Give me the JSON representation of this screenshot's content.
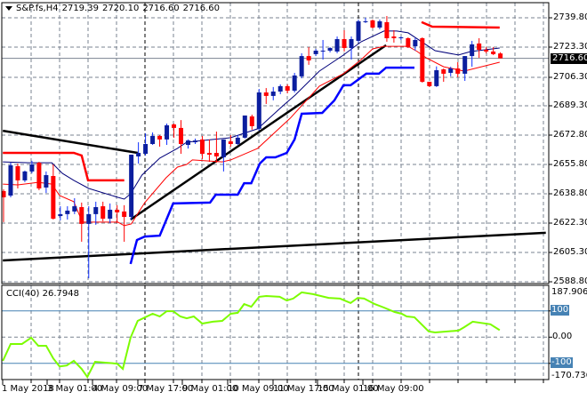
{
  "header": {
    "symbol": "S&P.fs,H4",
    "open": "2719.39",
    "high": "2720.10",
    "low": "2716.60",
    "close": "2716.60"
  },
  "price_axis": {
    "labels": [
      "2739.80",
      "2723.30",
      "2706.30",
      "2689.30",
      "2672.80",
      "2655.80",
      "2638.80",
      "2622.30",
      "2605.30",
      "2588.80"
    ],
    "current": "2716.60"
  },
  "cci": {
    "label": "CCI(40) 26.7948",
    "axis": {
      "max": "187.9065",
      "upper": "100",
      "zero": "0.00",
      "lower": "-100",
      "min": "-170.7363"
    }
  },
  "time_axis": {
    "labels": [
      "1 May 2018",
      "3 May 01:00",
      "4 May 09:00",
      "7 May 17:00",
      "9 May 01:00",
      "10 May 09:00",
      "11 May 17:00",
      "15 May 01:00",
      "16 May 09:00"
    ]
  },
  "colors": {
    "bull": "#0b1e9e",
    "bear": "#ff0000",
    "ma_fast": "#00007a",
    "ma_slow": "#ff0000",
    "channel_low": "#0000ff",
    "channel_high": "#ff0000",
    "trend": "#000000",
    "cci": "#7cfc00",
    "level": "#4682b4",
    "grid": "#7a8391"
  },
  "chart_data": {
    "type": "candlestick",
    "title": "S&P.fs,H4",
    "ylim": [
      2588.8,
      2739.8
    ],
    "ohlc": [
      [
        2640.7,
        2641.7,
        2622.9,
        2637.1
      ],
      [
        2638.1,
        2656.9,
        2637.1,
        2655.4
      ],
      [
        2654.9,
        2656.4,
        2642.2,
        2646.8
      ],
      [
        2646.8,
        2652.4,
        2645.8,
        2651.9
      ],
      [
        2651.9,
        2658.0,
        2650.9,
        2655.9
      ],
      [
        2656.9,
        2657.4,
        2641.2,
        2642.2
      ],
      [
        2642.7,
        2651.9,
        2639.6,
        2649.8
      ],
      [
        2649.3,
        2655.9,
        2624.4,
        2624.9
      ],
      [
        2626.4,
        2632.0,
        2623.9,
        2627.5
      ],
      [
        2627.5,
        2632.0,
        2624.4,
        2629.5
      ],
      [
        2629.0,
        2636.6,
        2627.5,
        2632.0
      ],
      [
        2631.5,
        2634.1,
        2611.7,
        2621.9
      ],
      [
        2621.9,
        2632.0,
        2590.8,
        2627.5
      ],
      [
        2627.5,
        2634.6,
        2621.4,
        2631.5
      ],
      [
        2632.0,
        2634.6,
        2623.4,
        2624.9
      ],
      [
        2624.9,
        2633.6,
        2622.4,
        2630.0
      ],
      [
        2630.0,
        2632.6,
        2622.4,
        2628.5
      ],
      [
        2629.0,
        2632.6,
        2611.7,
        2625.9
      ],
      [
        2625.9,
        2661.5,
        2624.4,
        2661.5
      ],
      [
        2660.5,
        2668.6,
        2656.4,
        2662.5
      ],
      [
        2662.0,
        2673.7,
        2661.0,
        2667.6
      ],
      [
        2667.6,
        2674.2,
        2667.1,
        2672.2
      ],
      [
        2672.2,
        2672.7,
        2666.1,
        2670.2
      ],
      [
        2670.2,
        2679.3,
        2667.1,
        2678.3
      ],
      [
        2678.8,
        2679.3,
        2671.2,
        2676.8
      ],
      [
        2676.8,
        2681.3,
        2662.0,
        2667.6
      ],
      [
        2667.1,
        2670.2,
        2665.0,
        2669.6
      ],
      [
        2668.6,
        2670.7,
        2667.6,
        2669.6
      ],
      [
        2670.2,
        2672.2,
        2659.0,
        2662.0
      ],
      [
        2662.5,
        2670.2,
        2657.4,
        2661.5
      ],
      [
        2662.5,
        2674.7,
        2656.9,
        2660.5
      ],
      [
        2660.0,
        2670.2,
        2651.9,
        2670.2
      ],
      [
        2669.1,
        2672.7,
        2666.1,
        2667.6
      ],
      [
        2667.6,
        2672.7,
        2667.1,
        2671.2
      ],
      [
        2671.2,
        2683.9,
        2670.7,
        2683.9
      ],
      [
        2683.4,
        2684.4,
        2675.8,
        2677.8
      ],
      [
        2676.3,
        2699.1,
        2675.3,
        2697.1
      ],
      [
        2697.1,
        2699.6,
        2690.5,
        2695.1
      ],
      [
        2695.1,
        2700.2,
        2692.6,
        2697.6
      ],
      [
        2697.6,
        2701.7,
        2696.1,
        2700.7
      ],
      [
        2700.7,
        2701.7,
        2696.6,
        2698.1
      ],
      [
        2698.1,
        2708.3,
        2697.1,
        2706.8
      ],
      [
        2706.3,
        2719.5,
        2705.2,
        2717.9
      ],
      [
        2717.9,
        2723.0,
        2712.9,
        2715.4
      ],
      [
        2719.0,
        2722.0,
        2717.9,
        2721.0
      ],
      [
        2720.5,
        2727.1,
        2715.9,
        2721.0
      ],
      [
        2721.0,
        2723.0,
        2720.0,
        2722.5
      ],
      [
        2720.5,
        2729.1,
        2719.5,
        2727.6
      ],
      [
        2727.6,
        2732.7,
        2720.5,
        2722.5
      ],
      [
        2722.5,
        2729.1,
        2715.9,
        2727.6
      ],
      [
        2726.6,
        2738.8,
        2725.6,
        2737.8
      ],
      [
        2737.3,
        2739.8,
        2736.8,
        2737.8
      ],
      [
        2738.3,
        2738.8,
        2733.7,
        2734.2
      ],
      [
        2734.2,
        2738.8,
        2733.2,
        2737.8
      ],
      [
        2737.3,
        2740.8,
        2726.1,
        2728.1
      ],
      [
        2729.1,
        2732.7,
        2725.6,
        2728.1
      ],
      [
        2728.1,
        2729.1,
        2727.1,
        2728.6
      ],
      [
        2728.1,
        2728.6,
        2722.5,
        2723.0
      ],
      [
        2723.5,
        2728.1,
        2721.0,
        2727.1
      ],
      [
        2728.1,
        2728.6,
        2702.7,
        2703.2
      ],
      [
        2703.2,
        2703.2,
        2700.2,
        2700.7
      ],
      [
        2700.7,
        2712.0,
        2700.2,
        2709.8
      ],
      [
        2710.3,
        2710.8,
        2703.2,
        2707.8
      ],
      [
        2708.3,
        2711.8,
        2706.3,
        2710.8
      ],
      [
        2710.8,
        2714.4,
        2705.8,
        2707.8
      ],
      [
        2707.8,
        2717.9,
        2703.7,
        2717.9
      ],
      [
        2717.9,
        2726.6,
        2711.8,
        2724.6
      ],
      [
        2725.1,
        2728.1,
        2716.9,
        2721.5
      ],
      [
        2721.5,
        2723.0,
        2719.5,
        2720.5
      ],
      [
        2720.5,
        2723.0,
        2718.5,
        2719.0
      ],
      [
        2719.39,
        2720.1,
        2716.6,
        2716.6
      ]
    ],
    "current_price": 2716.6,
    "indicators": {
      "ma_fast": [
        [
          -0.1,
          2657.4
        ],
        [
          3.6,
          2656.9
        ],
        [
          6.8,
          2656.9
        ],
        [
          8.3,
          2650.8
        ],
        [
          9.9,
          2646.8
        ],
        [
          12,
          2642.2
        ],
        [
          16.1,
          2637.1
        ],
        [
          17,
          2636.1
        ],
        [
          17.9,
          2639.1
        ],
        [
          19.5,
          2649.8
        ],
        [
          22,
          2659.5
        ],
        [
          24.5,
          2665.1
        ],
        [
          25.8,
          2668.6
        ],
        [
          29.5,
          2670.2
        ],
        [
          32,
          2671.2
        ],
        [
          35.8,
          2676.3
        ],
        [
          39.5,
          2690.0
        ],
        [
          41.1,
          2695.6
        ],
        [
          44.5,
          2709.3
        ],
        [
          47.9,
          2718.5
        ],
        [
          50.4,
          2726.1
        ],
        [
          53.6,
          2732.2
        ],
        [
          55.4,
          2732.2
        ],
        [
          57,
          2731.2
        ],
        [
          60.8,
          2721.0
        ],
        [
          64.1,
          2718.5
        ],
        [
          65.8,
          2720.5
        ],
        [
          69.9,
          2722.5
        ]
      ],
      "ma_slow": [
        [
          -0.1,
          2644.7
        ],
        [
          2,
          2644.2
        ],
        [
          4.9,
          2645.7
        ],
        [
          6.8,
          2644.7
        ],
        [
          7.9,
          2638.1
        ],
        [
          9.9,
          2634.6
        ],
        [
          11.1,
          2622.9
        ],
        [
          16.1,
          2622.9
        ],
        [
          17,
          2620.9
        ],
        [
          18,
          2621.9
        ],
        [
          19.9,
          2634.1
        ],
        [
          22.9,
          2648.3
        ],
        [
          24.5,
          2654.4
        ],
        [
          25.8,
          2655.9
        ],
        [
          26.6,
          2658.5
        ],
        [
          30.8,
          2657.4
        ],
        [
          32,
          2658.5
        ],
        [
          35.8,
          2665.1
        ],
        [
          40.4,
          2682.4
        ],
        [
          44.5,
          2700.7
        ],
        [
          47.9,
          2707.8
        ],
        [
          50.4,
          2715.9
        ],
        [
          52,
          2722.0
        ],
        [
          53.6,
          2723.5
        ],
        [
          57,
          2723.5
        ],
        [
          58.3,
          2720.5
        ],
        [
          59.5,
          2717.0
        ],
        [
          62,
          2711.8
        ],
        [
          64.9,
          2709.3
        ],
        [
          69.9,
          2714.4
        ]
      ],
      "channel_high": [
        [
          [
            -0.1,
            2662.5
          ],
          [
            9.9,
            2662.5
          ],
          [
            11,
            2661.0
          ],
          [
            11.9,
            2646.8
          ],
          [
            17,
            2646.8
          ]
        ],
        [
          [
            58.9,
            2737.3
          ],
          [
            60.4,
            2734.7
          ],
          [
            69.9,
            2734.2
          ]
        ]
      ],
      "channel_low": [
        [
          17.9,
          2599.0
        ],
        [
          18.8,
          2612.7
        ],
        [
          19.9,
          2614.7
        ],
        [
          22,
          2615.2
        ],
        [
          23.9,
          2633.6
        ],
        [
          29.1,
          2634.1
        ],
        [
          29.9,
          2638.6
        ],
        [
          33,
          2638.6
        ],
        [
          33.9,
          2645.2
        ],
        [
          34.9,
          2645.2
        ],
        [
          36.1,
          2656.4
        ],
        [
          37,
          2660.0
        ],
        [
          38.3,
          2660.0
        ],
        [
          39.9,
          2662.5
        ],
        [
          41,
          2670.2
        ],
        [
          42,
          2684.9
        ],
        [
          44.9,
          2685.4
        ],
        [
          46.6,
          2692.5
        ],
        [
          47.9,
          2701.2
        ],
        [
          48.9,
          2701.2
        ],
        [
          51.1,
          2707.8
        ],
        [
          52.9,
          2707.8
        ],
        [
          53.9,
          2711.3
        ],
        [
          57.9,
          2711.3
        ]
      ],
      "trendlines": [
        [
          [
            -0.1,
            2675.2
          ],
          [
            18.9,
            2662.5
          ]
        ],
        [
          [
            17.9,
            2624.4
          ],
          [
            53.9,
            2724.1
          ]
        ],
        [
          [
            -0.1,
            2601.0
          ],
          [
            76.4,
            2616.8
          ]
        ]
      ]
    },
    "cci": {
      "period": 40,
      "levels": [
        100,
        0,
        -100
      ],
      "ylim": [
        -170.7363,
        187.9065
      ],
      "points": [
        [
          -0.1,
          -90
        ],
        [
          1,
          -26
        ],
        [
          2.6,
          -26
        ],
        [
          3.9,
          -2
        ],
        [
          4.9,
          -33
        ],
        [
          6,
          -33
        ],
        [
          7,
          -81
        ],
        [
          7.9,
          -112
        ],
        [
          8.9,
          -108
        ],
        [
          9.9,
          -90
        ],
        [
          11,
          -121
        ],
        [
          11.8,
          -152
        ],
        [
          12.9,
          -94
        ],
        [
          16,
          -101
        ],
        [
          16.8,
          -121
        ],
        [
          17.9,
          -2
        ],
        [
          18.9,
          62
        ],
        [
          21,
          89
        ],
        [
          22,
          79
        ],
        [
          23,
          99
        ],
        [
          23.9,
          99
        ],
        [
          24.9,
          79
        ],
        [
          25.8,
          72
        ],
        [
          26.8,
          79
        ],
        [
          28,
          52
        ],
        [
          29.5,
          59
        ],
        [
          30.8,
          62
        ],
        [
          32,
          89
        ],
        [
          33,
          93
        ],
        [
          33.9,
          126
        ],
        [
          34.9,
          116
        ],
        [
          36,
          154
        ],
        [
          37,
          157
        ],
        [
          38.9,
          154
        ],
        [
          39.9,
          140
        ],
        [
          40.8,
          147
        ],
        [
          42,
          171
        ],
        [
          43.6,
          164
        ],
        [
          45.8,
          150
        ],
        [
          47.4,
          147
        ],
        [
          48.9,
          130
        ],
        [
          49.9,
          150
        ],
        [
          50.8,
          147
        ],
        [
          52.3,
          126
        ],
        [
          53.6,
          113
        ],
        [
          55.1,
          96
        ],
        [
          56.1,
          89
        ],
        [
          56.8,
          79
        ],
        [
          57.9,
          76
        ],
        [
          59.9,
          22
        ],
        [
          60.8,
          18
        ],
        [
          64.1,
          25
        ],
        [
          64.9,
          38
        ],
        [
          66.1,
          59
        ],
        [
          68.6,
          49
        ],
        [
          69.9,
          26.79
        ]
      ]
    }
  }
}
